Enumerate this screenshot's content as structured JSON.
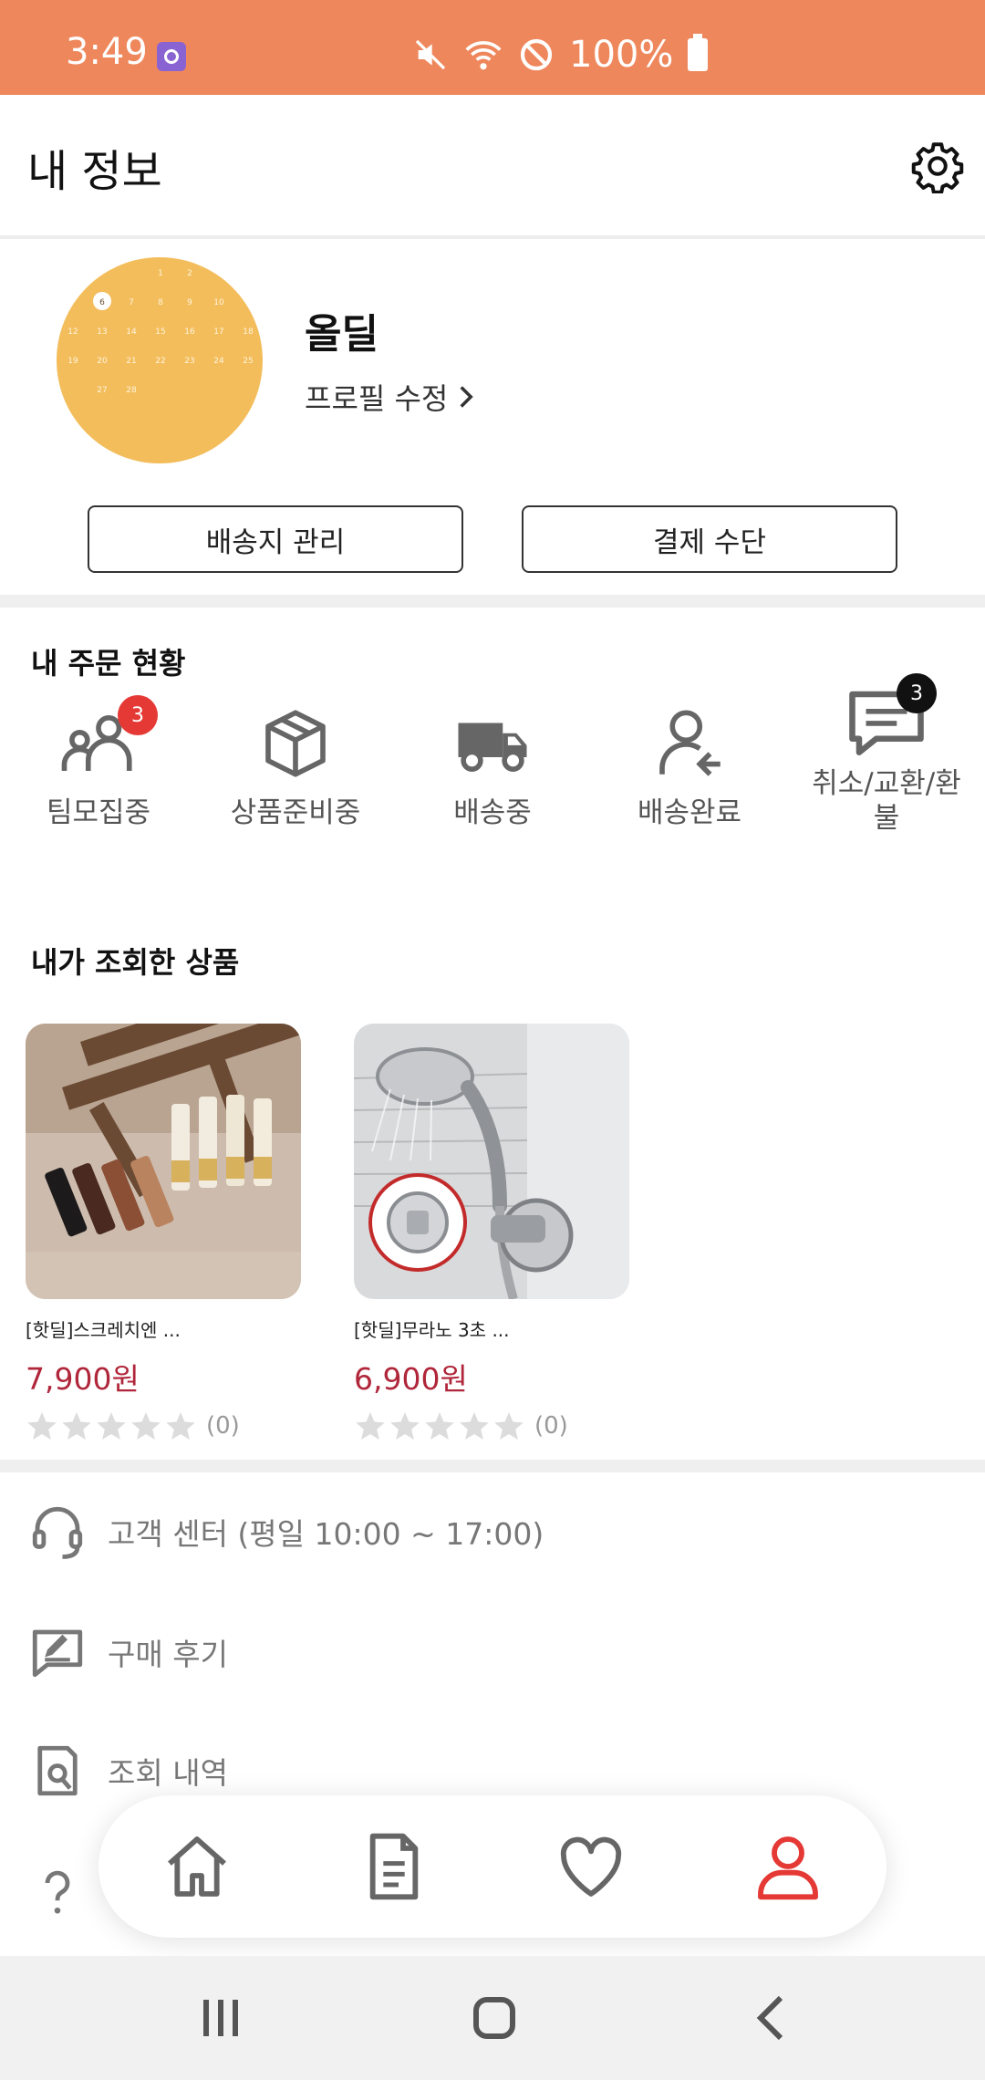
{
  "status_bar": {
    "time": "3:49",
    "battery": "100%",
    "background": "#ef875c"
  },
  "header": {
    "title": "내 정보"
  },
  "profile": {
    "name": "올딜",
    "edit_label": "프로필 수정",
    "avatar_numbers": [
      "1",
      "2",
      "6",
      "7",
      "8",
      "9",
      "10",
      "12",
      "13",
      "14",
      "15",
      "16",
      "17",
      "18",
      "19",
      "20",
      "21",
      "22",
      "23",
      "24",
      "25",
      "27",
      "28"
    ]
  },
  "buttons": {
    "address": "배송지 관리",
    "payment": "결제 수단"
  },
  "orders": {
    "title": "내 주문 현황",
    "items": [
      {
        "label": "팀모집중",
        "badge": "3"
      },
      {
        "label": "상품준비중"
      },
      {
        "label": "배송중"
      },
      {
        "label": "배송완료"
      },
      {
        "label": "취소/교환/환\n불",
        "badge": "3"
      }
    ]
  },
  "viewed": {
    "title": "내가 조회한 상품",
    "products": [
      {
        "name": "[핫딜]스크레치엔 ...",
        "price": "7,900원",
        "rating_count": "(0)",
        "rating": 0
      },
      {
        "name": "[핫딜]무라노 3초 ...",
        "price": "6,900원",
        "rating_count": "(0)",
        "rating": 0
      }
    ]
  },
  "menu": [
    {
      "label": "고객 센터 (평일 10:00 ~ 17:00)",
      "icon": "headset-icon"
    },
    {
      "label": "구매 후기",
      "icon": "review-icon"
    },
    {
      "label": "조회 내역",
      "icon": "history-search-icon"
    },
    {
      "label": "",
      "icon": "question-icon"
    }
  ],
  "bottom_nav": {
    "items": [
      "home-icon",
      "document-icon",
      "heart-icon",
      "person-icon"
    ],
    "active": "person-icon",
    "active_color": "#e53935"
  }
}
